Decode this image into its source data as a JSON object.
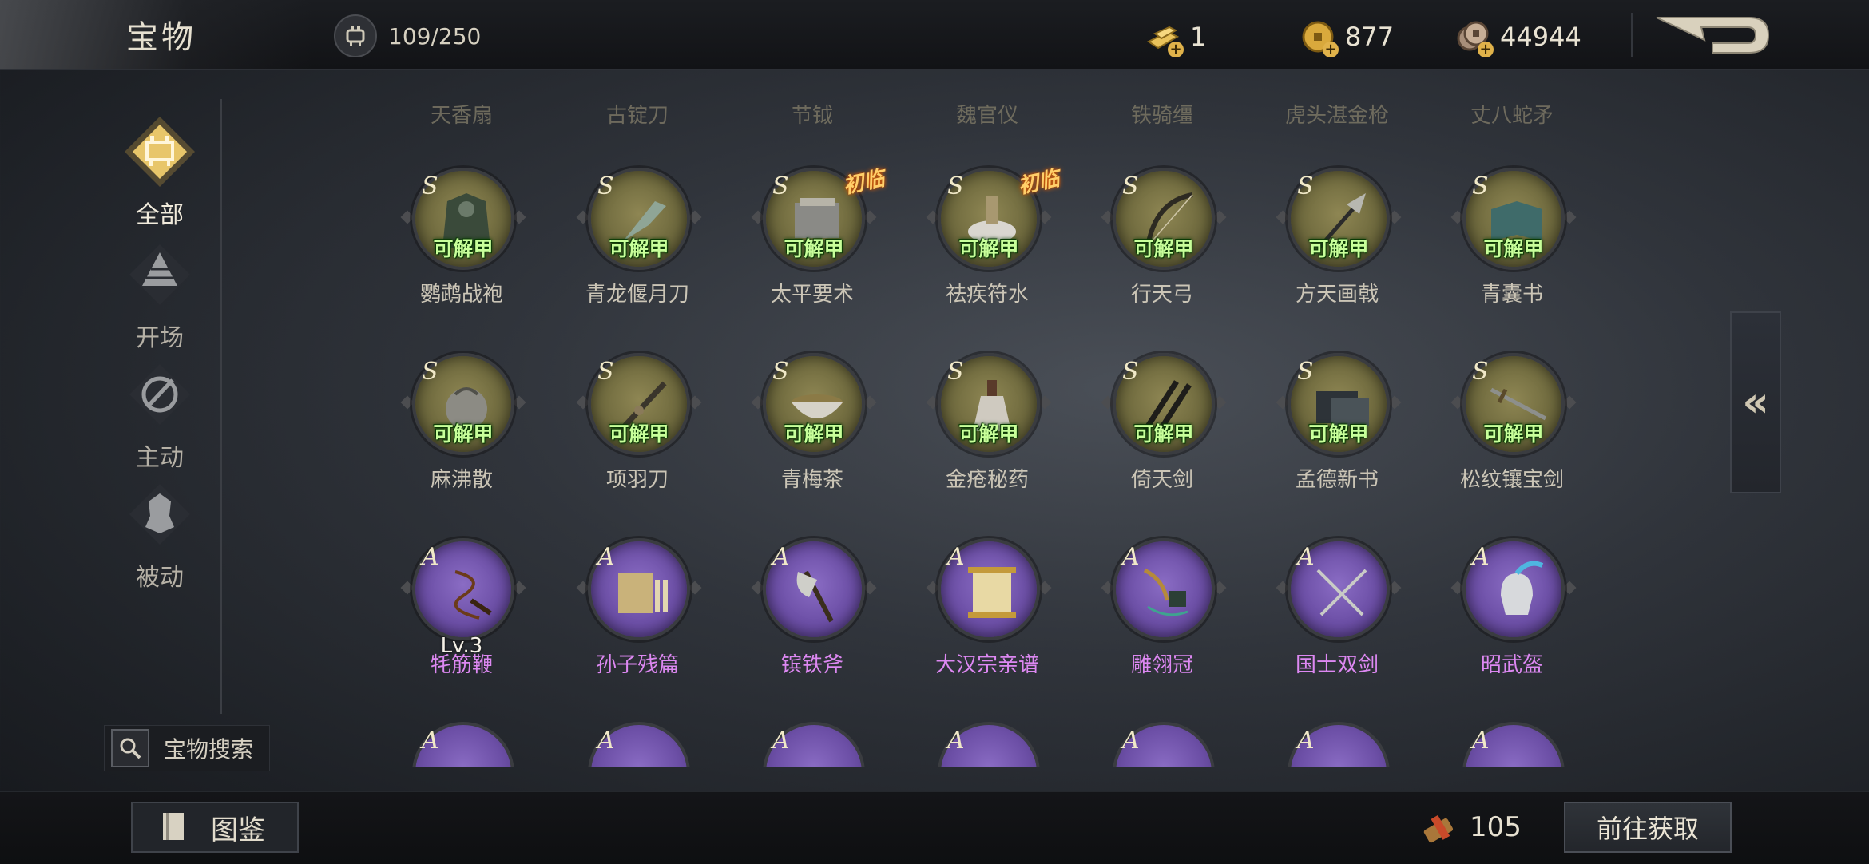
{
  "header": {
    "title": "宝物",
    "capacity": "109/250",
    "currencies": [
      {
        "icon": "gold-bar-icon",
        "value": "1"
      },
      {
        "icon": "gold-coin-icon",
        "value": "877"
      },
      {
        "icon": "copper-coin-icon",
        "value": "44944"
      }
    ]
  },
  "sidebar": {
    "categories": [
      {
        "label": "全部",
        "icon": "all-cauldron-icon",
        "active": true
      },
      {
        "label": "开场",
        "icon": "opening-pyramid-icon",
        "active": false
      },
      {
        "label": "主动",
        "icon": "active-skill-icon",
        "active": false
      },
      {
        "label": "被动",
        "icon": "passive-armor-icon",
        "active": false
      }
    ],
    "search_label": "宝物搜索"
  },
  "grid": {
    "partial_headers": [
      "天香扇",
      "古锭刀",
      "节钺",
      "魏官仪",
      "铁骑缰",
      "虎头湛金枪",
      "丈八蛇矛"
    ],
    "rows": [
      [
        {
          "grade": "S",
          "name": "鹦鹉战袍",
          "badge": "可解甲"
        },
        {
          "grade": "S",
          "name": "青龙偃月刀",
          "badge": "可解甲"
        },
        {
          "grade": "S",
          "name": "太平要术",
          "badge": "可解甲",
          "tag": "初临"
        },
        {
          "grade": "S",
          "name": "祛疾符水",
          "badge": "可解甲",
          "tag": "初临"
        },
        {
          "grade": "S",
          "name": "行天弓",
          "badge": "可解甲"
        },
        {
          "grade": "S",
          "name": "方天画戟",
          "badge": "可解甲"
        },
        {
          "grade": "S",
          "name": "青囊书",
          "badge": "可解甲"
        }
      ],
      [
        {
          "grade": "S",
          "name": "麻沸散",
          "badge": "可解甲"
        },
        {
          "grade": "S",
          "name": "项羽刀",
          "badge": "可解甲"
        },
        {
          "grade": "S",
          "name": "青梅茶",
          "badge": "可解甲"
        },
        {
          "grade": "S",
          "name": "金疮秘药",
          "badge": "可解甲"
        },
        {
          "grade": "S",
          "name": "倚天剑",
          "badge": "可解甲"
        },
        {
          "grade": "S",
          "name": "孟德新书",
          "badge": "可解甲"
        },
        {
          "grade": "S",
          "name": "松纹镶宝剑",
          "badge": "可解甲"
        }
      ],
      [
        {
          "grade": "A",
          "name": "牦筋鞭",
          "level": "Lv.3"
        },
        {
          "grade": "A",
          "name": "孙子残篇"
        },
        {
          "grade": "A",
          "name": "镔铁斧"
        },
        {
          "grade": "A",
          "name": "大汉宗亲谱"
        },
        {
          "grade": "A",
          "name": "雕翎冠"
        },
        {
          "grade": "A",
          "name": "国士双剑"
        },
        {
          "grade": "A",
          "name": "昭武盔"
        }
      ]
    ],
    "partial_row_grades": [
      "A",
      "A",
      "A",
      "A",
      "A",
      "A",
      "A"
    ]
  },
  "footer": {
    "codex_label": "图鉴",
    "owned_count": "105",
    "goto_label": "前往获取"
  },
  "colors": {
    "grade_s_bg": "#6f6a3e",
    "grade_a_bg": "#6c4fa6",
    "badge_green": "#c8ff9a",
    "name_a_purple": "#dd88f2",
    "tag_orange": "#ffcf6a"
  }
}
